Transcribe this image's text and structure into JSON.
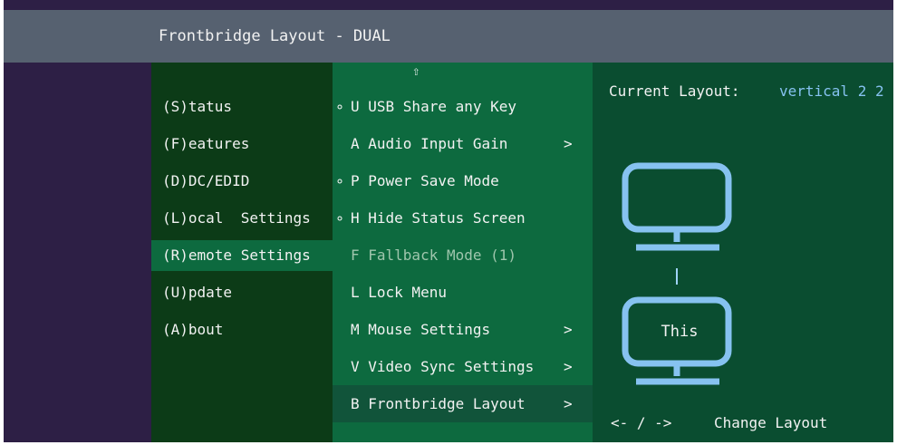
{
  "title": "Frontbridge Layout - DUAL",
  "left_menu": [
    {
      "label": "(S)tatus",
      "selected": false
    },
    {
      "label": "(F)eatures",
      "selected": false
    },
    {
      "label": "(D)DC/EDID",
      "selected": false
    },
    {
      "label": "(L)ocal  Settings",
      "selected": false
    },
    {
      "label": "(R)emote Settings",
      "selected": true
    },
    {
      "label": "(U)pdate",
      "selected": false
    },
    {
      "label": "(A)bout",
      "selected": false
    }
  ],
  "middle_menu": {
    "scroll_up_glyph": "⇧",
    "items": [
      {
        "bullet": "∘",
        "label": "U USB Share any Key",
        "arrow": "",
        "dim": false,
        "selected": false
      },
      {
        "bullet": "",
        "label": "A Audio Input Gain",
        "arrow": ">",
        "dim": false,
        "selected": false
      },
      {
        "bullet": "∘",
        "label": "P Power Save Mode",
        "arrow": "",
        "dim": false,
        "selected": false
      },
      {
        "bullet": "∘",
        "label": "H Hide Status Screen",
        "arrow": "",
        "dim": false,
        "selected": false
      },
      {
        "bullet": "",
        "label": "F Fallback Mode (1)",
        "arrow": "",
        "dim": true,
        "selected": false
      },
      {
        "bullet": "",
        "label": "L Lock Menu",
        "arrow": "",
        "dim": false,
        "selected": false
      },
      {
        "bullet": "",
        "label": "M Mouse Settings",
        "arrow": ">",
        "dim": false,
        "selected": false
      },
      {
        "bullet": "",
        "label": "V Video Sync Settings",
        "arrow": ">",
        "dim": false,
        "selected": false
      },
      {
        "bullet": "",
        "label": "B Frontbridge Layout",
        "arrow": ">",
        "dim": false,
        "selected": true
      }
    ]
  },
  "right_panel": {
    "current_layout_label": "Current Layout:",
    "current_layout_value": "vertical 2 2",
    "this_monitor_label": "This",
    "hint_keys": "<- / ->",
    "hint_text": "Change Layout"
  },
  "colors": {
    "left_bg": "#0c3b17",
    "mid_bg": "#0d6a3f",
    "right_bg": "#0a4d30",
    "monitor_stroke": "#86c2f0"
  },
  "icons": [
    "monitor-icon",
    "monitor-icon",
    "scroll-up-arrow-icon"
  ]
}
